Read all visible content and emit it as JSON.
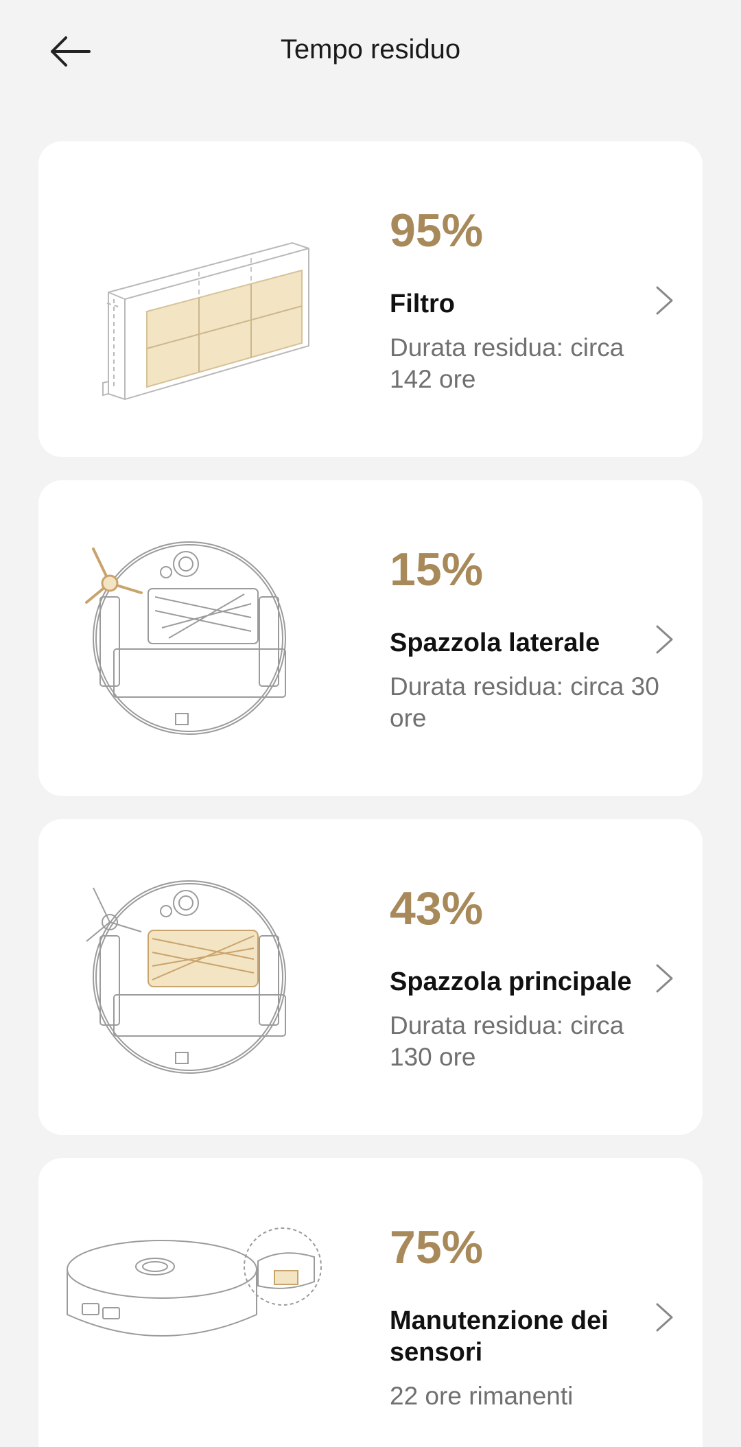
{
  "header": {
    "title": "Tempo residuo",
    "back_icon": "arrow-left-icon"
  },
  "colors": {
    "accent": "#a8895a",
    "background": "#f3f3f3",
    "card": "#ffffff",
    "secondary_text": "#707070"
  },
  "items": [
    {
      "percent": "95%",
      "name": "Filtro",
      "remaining": "Durata residua: circa 142 ore",
      "icon": "filter-illustration"
    },
    {
      "percent": "15%",
      "name": "Spazzola laterale",
      "remaining": "Durata residua: circa 30 ore",
      "icon": "side-brush-illustration"
    },
    {
      "percent": "43%",
      "name": "Spazzola principale",
      "remaining": "Durata residua: circa 130 ore",
      "icon": "main-brush-illustration"
    },
    {
      "percent": "75%",
      "name": "Manutenzione dei sensori",
      "remaining": "22 ore rimanenti",
      "icon": "sensor-illustration"
    }
  ]
}
